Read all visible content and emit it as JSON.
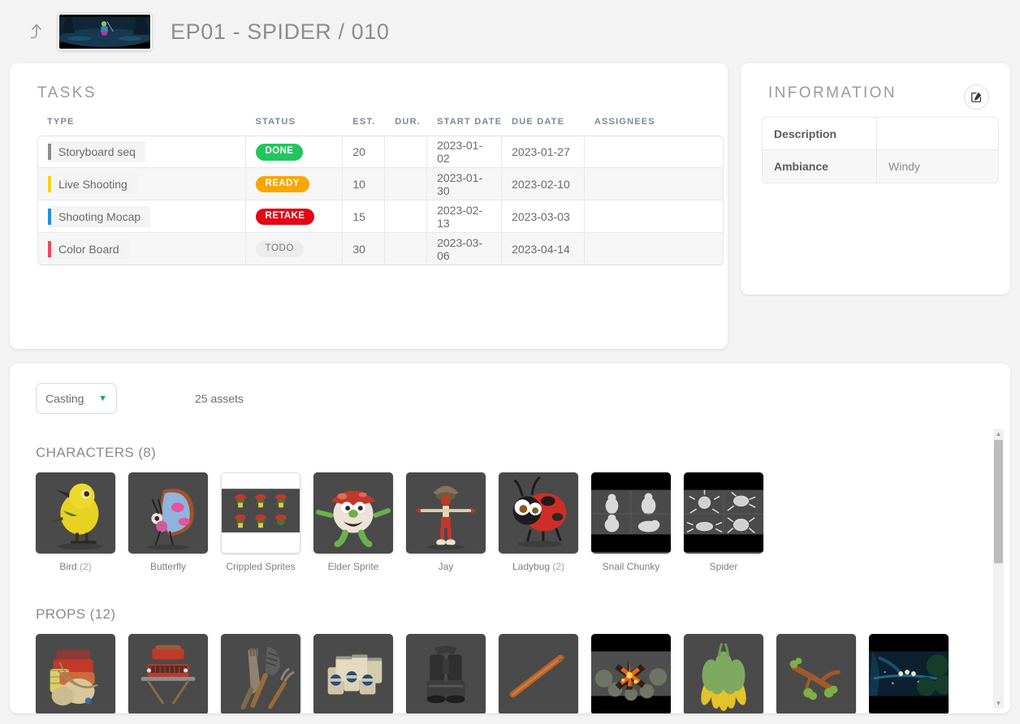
{
  "header": {
    "back_icon": "level-up-arrow-icon",
    "thumbnail_alt": "shot-preview-thumbnail",
    "title": "EP01 - SPIDER / 010"
  },
  "tasks_panel": {
    "title": "TASKS",
    "columns": [
      "TYPE",
      "STATUS",
      "EST.",
      "DUR.",
      "START DATE",
      "DUE DATE",
      "ASSIGNEES"
    ],
    "rows": [
      {
        "type": "Storyboard seq",
        "type_color": "#8c8c8c",
        "status": "DONE",
        "status_color": "#22c55e",
        "est": "20",
        "dur": "",
        "start_date": "2023-01-02",
        "due_date": "2023-01-27",
        "assignees": ""
      },
      {
        "type": "Live Shooting",
        "type_color": "#f7d117",
        "status": "READY",
        "status_color": "#f9a602",
        "est": "10",
        "dur": "",
        "start_date": "2023-01-30",
        "due_date": "2023-02-10",
        "assignees": ""
      },
      {
        "type": "Shooting Mocap",
        "type_color": "#1e90e8",
        "status": "RETAKE",
        "status_color": "#e30613",
        "est": "15",
        "dur": "",
        "start_date": "2023-02-13",
        "due_date": "2023-03-03",
        "assignees": ""
      },
      {
        "type": "Color Board",
        "type_color": "#f4455b",
        "status": "TODO",
        "status_color": "#ececec",
        "est": "30",
        "dur": "",
        "start_date": "2023-03-06",
        "due_date": "2023-04-14",
        "assignees": ""
      }
    ]
  },
  "information_panel": {
    "title": "INFORMATION",
    "edit_icon": "edit-pencil-square-icon",
    "fields": [
      {
        "label": "Description",
        "value": ""
      },
      {
        "label": "Ambiance",
        "value": "Windy"
      }
    ]
  },
  "casting_panel": {
    "filter_select": {
      "value": "Casting",
      "chevron_icon": "chevron-down-icon"
    },
    "asset_count": "25 assets",
    "groups": [
      {
        "title": "CHARACTERS (8)",
        "assets": [
          {
            "name": "Bird",
            "count": "(2)",
            "style": "bird"
          },
          {
            "name": "Butterfly",
            "count": "",
            "style": "butterfly"
          },
          {
            "name": "Crippled Sprites",
            "count": "",
            "style": "sprites"
          },
          {
            "name": "Elder Sprite",
            "count": "",
            "style": "elder"
          },
          {
            "name": "Jay",
            "count": "",
            "style": "jay"
          },
          {
            "name": "Ladybug",
            "count": "(2)",
            "style": "ladybug"
          },
          {
            "name": "Snail Chunky",
            "count": "",
            "style": "snail"
          },
          {
            "name": "Spider",
            "count": "",
            "style": "spider"
          }
        ]
      },
      {
        "title": "PROPS (12)",
        "assets": [
          {
            "name": "",
            "count": "",
            "style": "pack"
          },
          {
            "name": "",
            "count": "",
            "style": "grill"
          },
          {
            "name": "",
            "count": "",
            "style": "tools"
          },
          {
            "name": "",
            "count": "",
            "style": "cans"
          },
          {
            "name": "",
            "count": "",
            "style": "binocular"
          },
          {
            "name": "",
            "count": "",
            "style": "stick"
          },
          {
            "name": "",
            "count": "",
            "style": "campfire"
          },
          {
            "name": "",
            "count": "",
            "style": "flower"
          },
          {
            "name": "",
            "count": "",
            "style": "branch"
          },
          {
            "name": "",
            "count": "",
            "style": "forest"
          }
        ]
      }
    ],
    "scrollbar": {
      "up_icon": "triangle-up-icon",
      "down_icon": "triangle-down-icon"
    }
  }
}
